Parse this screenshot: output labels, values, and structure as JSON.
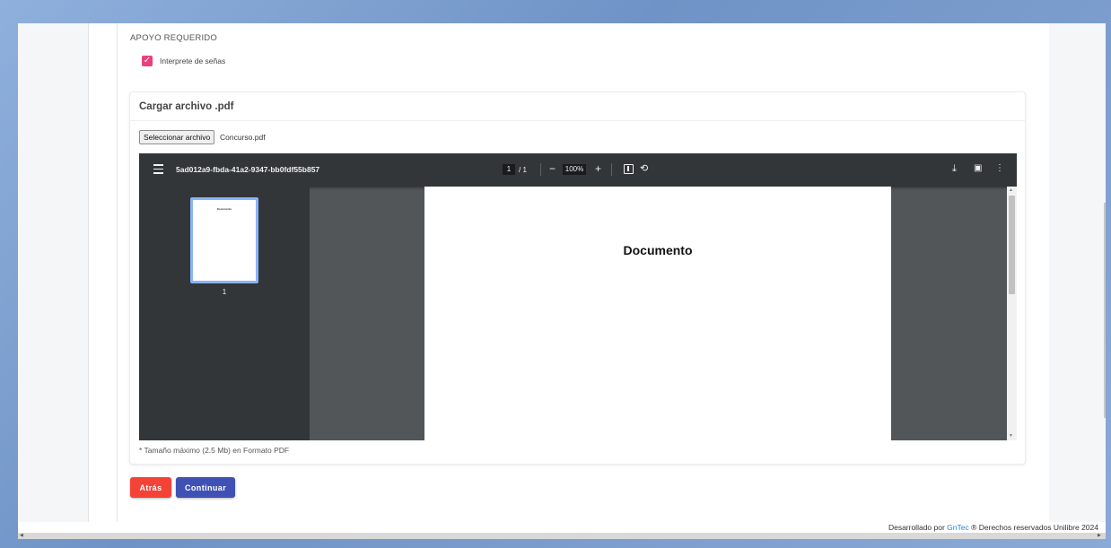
{
  "form": {
    "section_label": "APOYO REQUERIDO",
    "checkbox_label": "Interprete de señas",
    "checkbox_checked": true
  },
  "upload": {
    "card_title": "Cargar archivo .pdf",
    "file_button_label": "Seleccionar archivo",
    "file_name": "Concurso.pdf",
    "note": "* Tamaño máximo (2.5 Mb) en Formato PDF"
  },
  "viewer": {
    "doc_title": "5ad012a9-fbda-41a2-9347-bb0fdf55b857",
    "page_current": "1",
    "page_total": "/ 1",
    "zoom": "100%",
    "page_heading": "Documento",
    "thumbnail_page_number": "1",
    "icons": [
      "menu-icon",
      "zoom-out-icon",
      "zoom-in-icon",
      "fit-page-icon",
      "rotate-icon",
      "download-icon",
      "print-icon",
      "more-vert-icon"
    ]
  },
  "actions": {
    "back_label": "Atrás",
    "continue_label": "Continuar"
  },
  "footer": {
    "prefix": "Desarrollado por",
    "link": "GnTec",
    "suffix": "® Derechos reservados Unilibre 2024"
  },
  "colors": {
    "checkbox": "#ec407a",
    "back_button": "#f44336",
    "continue_button": "#3f51b5",
    "viewer_toolbar": "#323639",
    "viewer_background": "#525659",
    "link": "#1e88e5"
  }
}
